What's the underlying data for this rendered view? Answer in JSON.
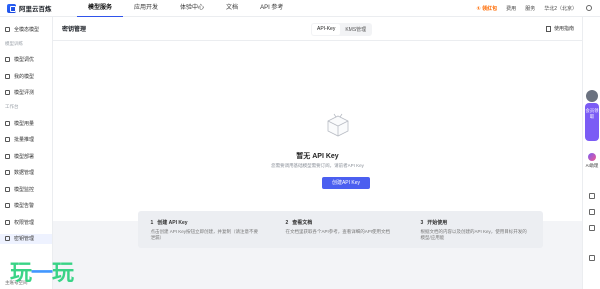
{
  "topbar": {
    "brand": "阿里云百炼",
    "nav": [
      "模型服务",
      "应用开发",
      "体验中心",
      "文档",
      "API 参考"
    ],
    "promo": "① 领红包",
    "links": [
      "费用",
      "服务"
    ],
    "workspace": "华北2（北京）"
  },
  "sidebar": {
    "items": [
      {
        "label": "全模态模型"
      },
      {
        "group": "模型训练"
      },
      {
        "label": "模型调优"
      },
      {
        "label": "我的模型"
      },
      {
        "label": "模型评测"
      },
      {
        "group": "工作台"
      },
      {
        "label": "模型用量"
      },
      {
        "label": "批量推理"
      },
      {
        "label": "模型部署"
      },
      {
        "label": "数据管理"
      },
      {
        "label": "模型监控"
      },
      {
        "label": "模型告警"
      },
      {
        "label": "权限管理"
      },
      {
        "label": "密钥管理"
      }
    ],
    "bottom": "主账号空间"
  },
  "header": {
    "title": "密钥管理",
    "tabs": [
      "API-Key",
      "KMS管理"
    ],
    "guide": "使用指南"
  },
  "empty": {
    "title": "暂无 API Key",
    "desc": "您需要调用基础模型需要订阅，请前者API Key",
    "button": "创建API Key"
  },
  "steps": [
    {
      "num": "1",
      "title": "创建 API Key",
      "desc": "点击创建 API Key按钮立即创建，并复制（请注意不要泄漏）"
    },
    {
      "num": "2",
      "title": "查看文档",
      "desc": "在文档里获取各个API参考，查看详细的API使用文档"
    },
    {
      "num": "3",
      "title": "开始使用",
      "desc": "根据文档的内容以及创建的API Key，使用目标开发的模型/应用能"
    }
  ],
  "rail": {
    "promo": "会员领取",
    "ai": "AI助理"
  },
  "watermark": {
    "left": "玩",
    "right": "玩"
  }
}
